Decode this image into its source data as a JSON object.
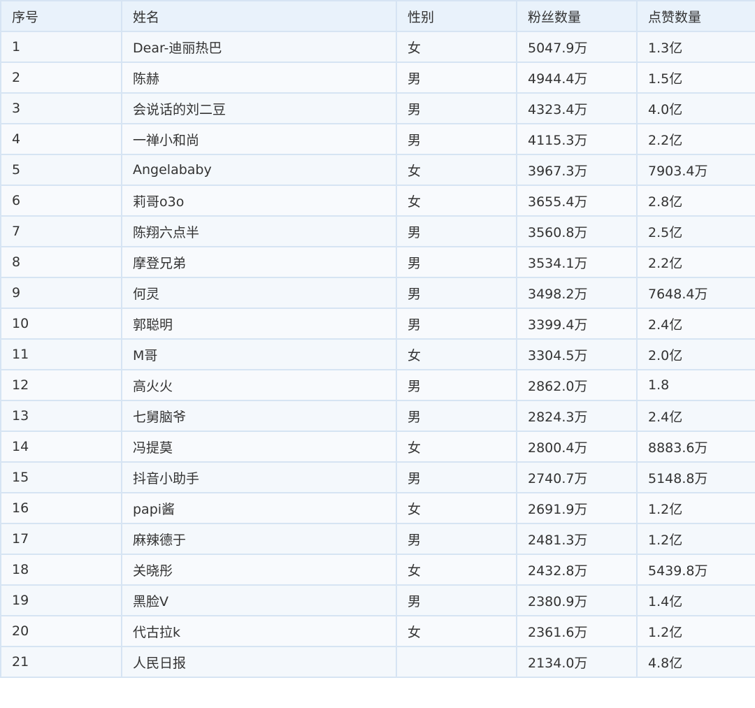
{
  "table": {
    "headers": [
      "序号",
      "姓名",
      "性别",
      "粉丝数量",
      "点赞数量"
    ],
    "rows": [
      [
        "1",
        "Dear-迪丽热巴",
        "女",
        "5047.9万",
        "1.3亿"
      ],
      [
        "2",
        "陈赫",
        "男",
        "4944.4万",
        "1.5亿"
      ],
      [
        "3",
        "会说话的刘二豆",
        "男",
        "4323.4万",
        "4.0亿"
      ],
      [
        "4",
        "一禅小和尚",
        "男",
        "4115.3万",
        "2.2亿"
      ],
      [
        "5",
        "Angelababy",
        "女",
        "3967.3万",
        "7903.4万"
      ],
      [
        "6",
        "莉哥o3o",
        "女",
        "3655.4万",
        "2.8亿"
      ],
      [
        "7",
        "陈翔六点半",
        "男",
        "3560.8万",
        "2.5亿"
      ],
      [
        "8",
        "摩登兄弟",
        "男",
        "3534.1万",
        "2.2亿"
      ],
      [
        "9",
        "何灵",
        "男",
        "3498.2万",
        "7648.4万"
      ],
      [
        "10",
        "郭聪明",
        "男",
        "3399.4万",
        "2.4亿"
      ],
      [
        "11",
        "M哥",
        "女",
        "3304.5万",
        "2.0亿"
      ],
      [
        "12",
        "高火火",
        "男",
        "2862.0万",
        "1.8"
      ],
      [
        "13",
        "七舅脑爷",
        "男",
        "2824.3万",
        "2.4亿"
      ],
      [
        "14",
        "冯提莫",
        "女",
        "2800.4万",
        "8883.6万"
      ],
      [
        "15",
        "抖音小助手",
        "男",
        "2740.7万",
        "5148.8万"
      ],
      [
        "16",
        "papi酱",
        "女",
        "2691.9万",
        "1.2亿"
      ],
      [
        "17",
        "麻辣德于",
        "男",
        "2481.3万",
        "1.2亿"
      ],
      [
        "18",
        "关晓彤",
        "女",
        "2432.8万",
        "5439.8万"
      ],
      [
        "19",
        "黑脸V",
        "男",
        "2380.9万",
        "1.4亿"
      ],
      [
        "20",
        "代古拉k",
        "女",
        "2361.6万",
        "1.2亿"
      ],
      [
        "21",
        "人民日报",
        "",
        "2134.0万",
        "4.8亿"
      ]
    ]
  }
}
